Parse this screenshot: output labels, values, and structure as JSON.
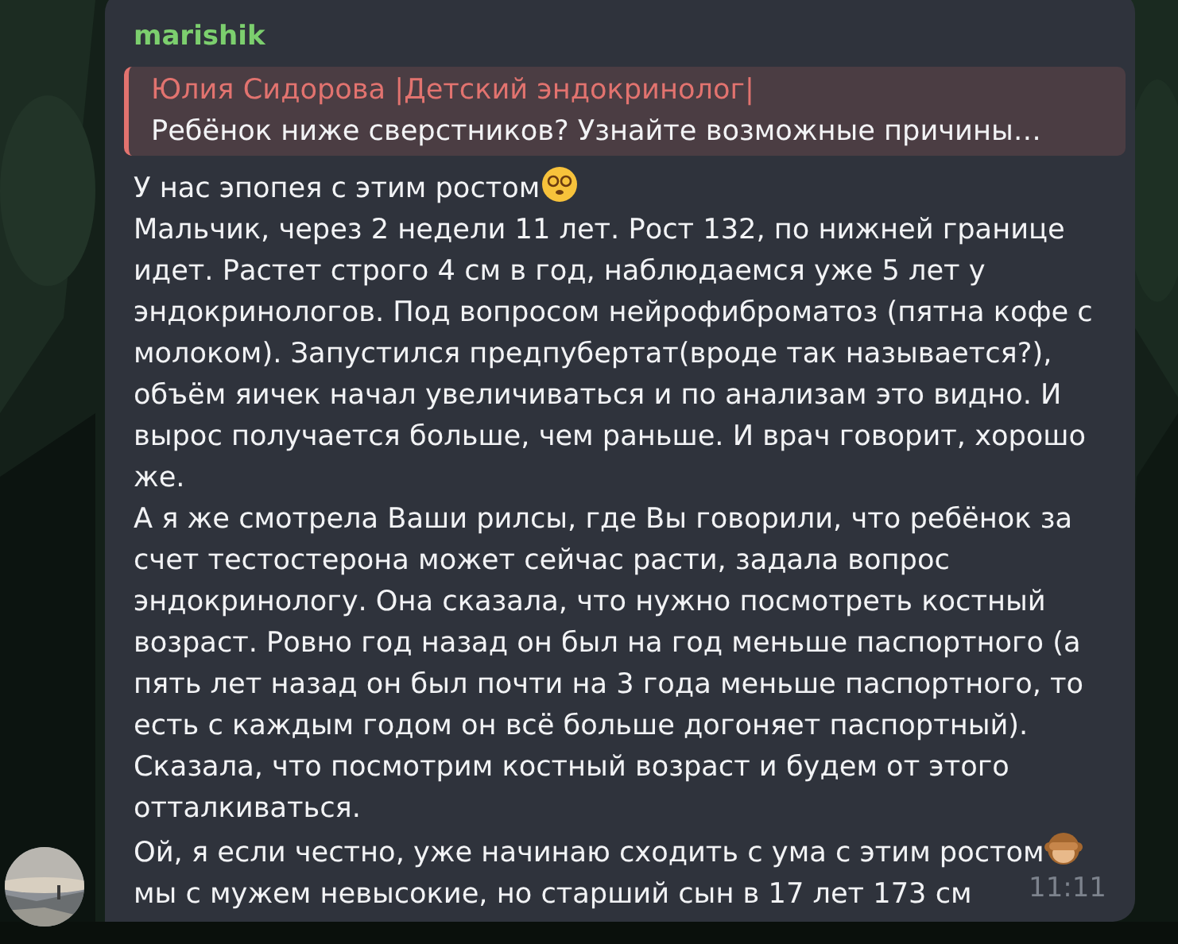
{
  "message": {
    "sender": "marishik",
    "reply": {
      "author": "Юлия Сидорова |Детский эндокринолог|",
      "text": "Ребёнок ниже сверстников? Узнайте возможные причины…"
    },
    "paragraphs": [
      {
        "text": "У нас эпопея с этим ростом",
        "kind": "dizzy"
      },
      {
        "kind": "plain",
        "text": "Мальчик, через 2 недели 11 лет. Рост 132, по нижней границе идет. Растет строго 4 см в год, наблюдаемся уже 5 лет у эндокринологов. Под вопросом нейрофиброматоз (пятна кофе с молоком). Запустился предпубертат(вроде так называется?), объём яичек начал увеличиваться и по анализам это видно. И вырос получается больше, чем раньше. И врач говорит, хорошо же."
      },
      {
        "kind": "plain",
        "text": "А я же смотрела Ваши рилсы, где Вы говорили, что ребёнок за счет тестостерона может сейчас расти, задала вопрос эндокринологу. Она сказала, что нужно посмотреть костный возраст. Ровно год назад он был на год меньше паспортного (а пять лет назад он был почти на 3 года меньше паспортного, то есть с каждым годом он всё больше догоняет паспортный). Сказала, что посмотрим костный возраст и будем от этого отталкиваться."
      },
      {
        "text": "Ой, я если честно, уже начинаю сходить с ума с этим ростом",
        "kind": "monkey"
      },
      {
        "text": "мы с мужем невысокие, но старший сын в 17 лет 173 см",
        "kind": "plain"
      }
    ],
    "time": "11:11"
  }
}
